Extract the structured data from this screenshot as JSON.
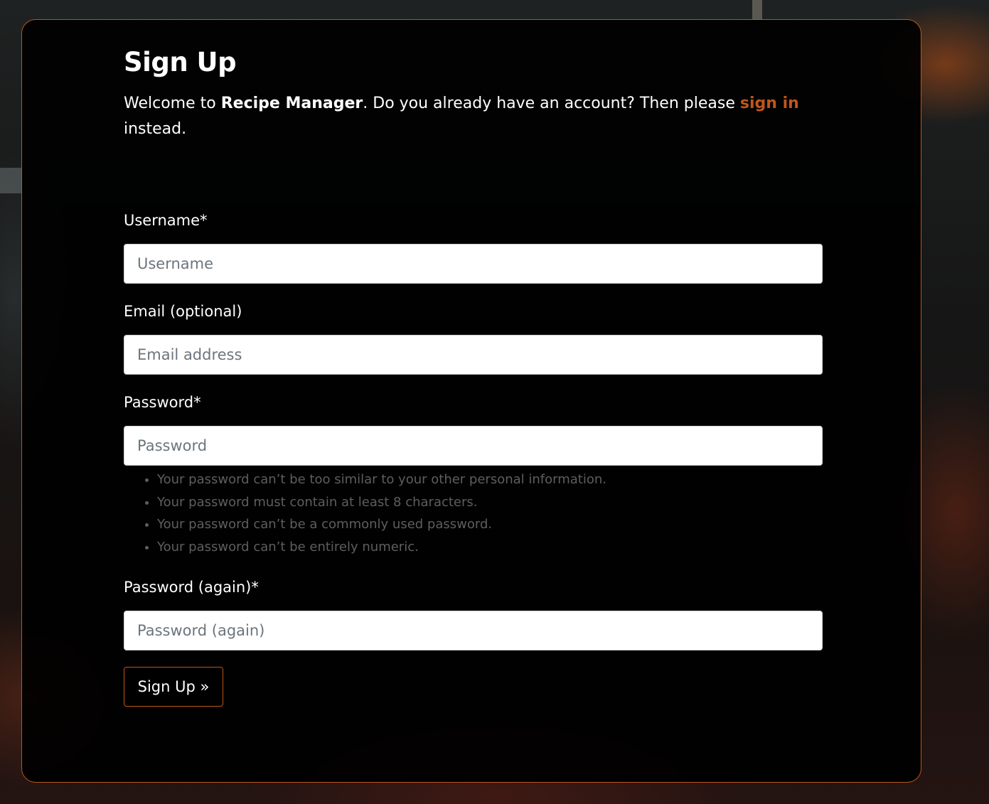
{
  "page": {
    "title": "Sign Up",
    "intro_prefix": "Welcome to ",
    "app_name": "Recipe Manager",
    "intro_middle": ". Do you already have an account? Then please ",
    "signin_link": "sign in",
    "intro_suffix": " instead."
  },
  "form": {
    "username": {
      "label": "Username*",
      "placeholder": "Username",
      "value": ""
    },
    "email": {
      "label": "Email (optional)",
      "placeholder": "Email address",
      "value": ""
    },
    "password": {
      "label": "Password*",
      "placeholder": "Password",
      "value": ""
    },
    "password_hints": [
      "Your password can’t be too similar to your other personal information.",
      "Your password must contain at least 8 characters.",
      "Your password can’t be a commonly used password.",
      "Your password can’t be entirely numeric."
    ],
    "password2": {
      "label": "Password (again)*",
      "placeholder": "Password (again)",
      "value": ""
    },
    "submit_label": "Sign Up »"
  },
  "colors": {
    "accent": "#c0561a",
    "card_border": "#b9561c",
    "card_bg": "#000000",
    "hint_text": "#5e5e5e"
  }
}
